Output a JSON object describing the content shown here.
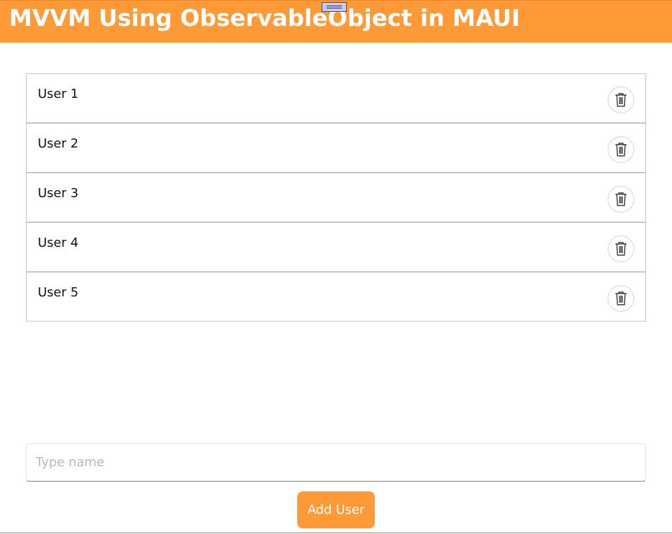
{
  "header": {
    "title": "MVVM Using ObservableObject in MAUI",
    "background_color": "#ff9a36"
  },
  "users": [
    {
      "name": "User 1",
      "delete_icon": "trash-icon"
    },
    {
      "name": "User 2",
      "delete_icon": "trash-icon"
    },
    {
      "name": "User 3",
      "delete_icon": "trash-icon"
    },
    {
      "name": "User 4",
      "delete_icon": "trash-icon"
    },
    {
      "name": "User 5",
      "delete_icon": "trash-icon"
    }
  ],
  "form": {
    "name_placeholder": "Type name",
    "name_value": "",
    "add_button_label": "Add User",
    "accent_color": "#ff9a36"
  }
}
